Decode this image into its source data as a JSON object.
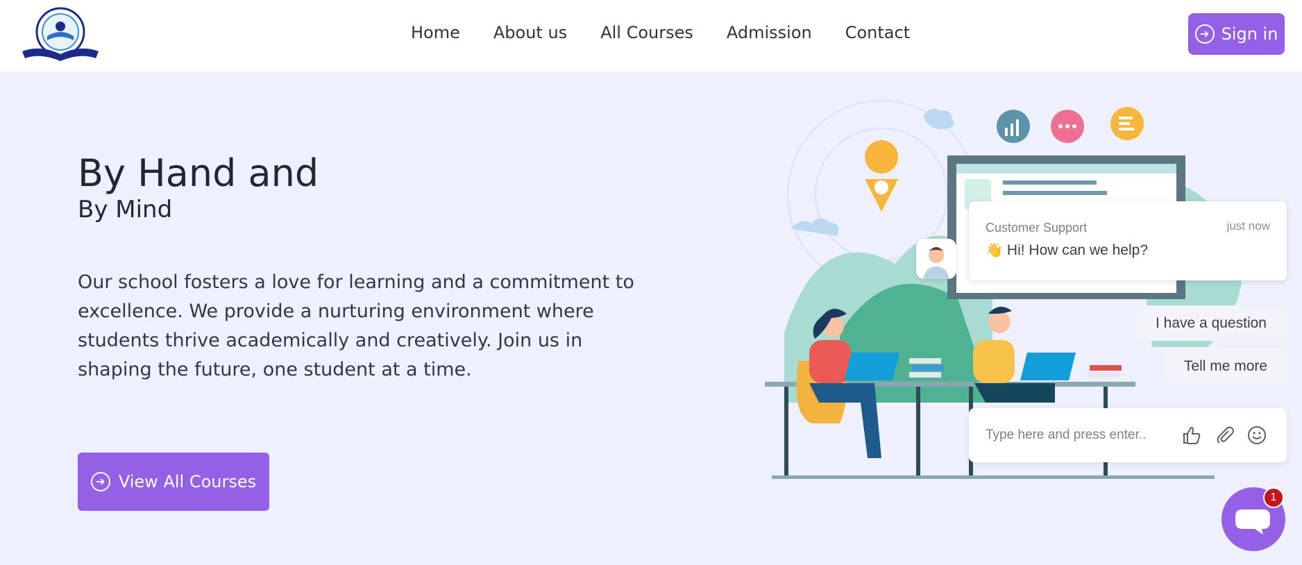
{
  "header": {
    "nav": [
      "Home",
      "About us",
      "All Courses",
      "Admission",
      "Contact"
    ],
    "signin_label": "Sign in"
  },
  "hero": {
    "title": "By Hand and",
    "subtitle": "By Mind",
    "description": "Our school fosters a love for learning and a commitment to excellence. We provide a nurturing environment where students thrive academically and creatively. Join us in shaping the future, one student at a time.",
    "cta_label": "View All Courses"
  },
  "chat": {
    "sender": "Customer Support",
    "time": "just now",
    "message": "Hi! How can we help?",
    "quick_replies": [
      "I have a question",
      "Tell me more"
    ],
    "input_placeholder": "Type here and press enter..",
    "unread_count": "1"
  },
  "colors": {
    "accent": "#9460e6",
    "background": "#eef1fd",
    "badge": "#c0171d"
  }
}
